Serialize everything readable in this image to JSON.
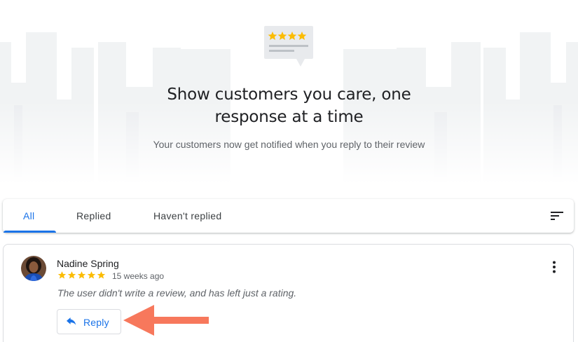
{
  "hero": {
    "title_line1": "Show customers you care, one",
    "title_line2": "response at a time",
    "subtitle": "Your customers now get notified when you reply to their review",
    "illustration_icon": "review-stars-card-icon"
  },
  "tabs": [
    {
      "label": "All",
      "active": true
    },
    {
      "label": "Replied",
      "active": false
    },
    {
      "label": "Haven't replied",
      "active": false
    }
  ],
  "sort_icon": "sort-icon",
  "review": {
    "name": "Nadine Spring",
    "rating": 5,
    "time": "15 weeks ago",
    "text": "The user didn't write a review, and has left just a rating.",
    "reply_label": "Reply",
    "more_icon": "more-vert-icon"
  },
  "colors": {
    "accent": "#1a73e8",
    "star": "#fbbc04",
    "annotation_arrow": "#f7785c",
    "muted_text": "#5f6368"
  }
}
